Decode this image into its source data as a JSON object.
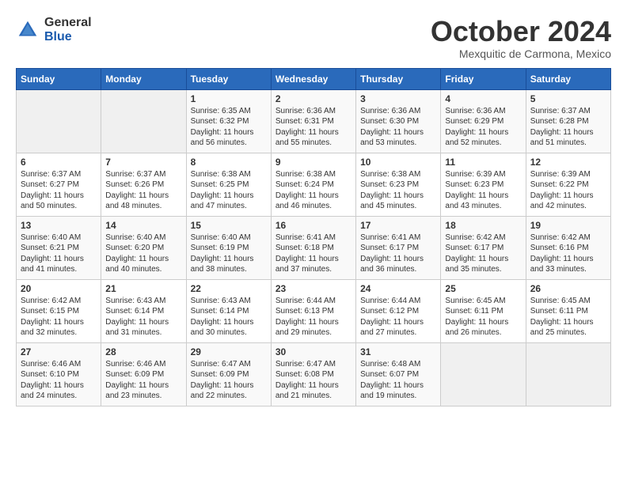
{
  "logo": {
    "general": "General",
    "blue": "Blue"
  },
  "title": "October 2024",
  "subtitle": "Mexquitic de Carmona, Mexico",
  "weekdays": [
    "Sunday",
    "Monday",
    "Tuesday",
    "Wednesday",
    "Thursday",
    "Friday",
    "Saturday"
  ],
  "weeks": [
    [
      {
        "day": "",
        "info": ""
      },
      {
        "day": "",
        "info": ""
      },
      {
        "day": "1",
        "info": "Sunrise: 6:35 AM\nSunset: 6:32 PM\nDaylight: 11 hours and 56 minutes."
      },
      {
        "day": "2",
        "info": "Sunrise: 6:36 AM\nSunset: 6:31 PM\nDaylight: 11 hours and 55 minutes."
      },
      {
        "day": "3",
        "info": "Sunrise: 6:36 AM\nSunset: 6:30 PM\nDaylight: 11 hours and 53 minutes."
      },
      {
        "day": "4",
        "info": "Sunrise: 6:36 AM\nSunset: 6:29 PM\nDaylight: 11 hours and 52 minutes."
      },
      {
        "day": "5",
        "info": "Sunrise: 6:37 AM\nSunset: 6:28 PM\nDaylight: 11 hours and 51 minutes."
      }
    ],
    [
      {
        "day": "6",
        "info": "Sunrise: 6:37 AM\nSunset: 6:27 PM\nDaylight: 11 hours and 50 minutes."
      },
      {
        "day": "7",
        "info": "Sunrise: 6:37 AM\nSunset: 6:26 PM\nDaylight: 11 hours and 48 minutes."
      },
      {
        "day": "8",
        "info": "Sunrise: 6:38 AM\nSunset: 6:25 PM\nDaylight: 11 hours and 47 minutes."
      },
      {
        "day": "9",
        "info": "Sunrise: 6:38 AM\nSunset: 6:24 PM\nDaylight: 11 hours and 46 minutes."
      },
      {
        "day": "10",
        "info": "Sunrise: 6:38 AM\nSunset: 6:23 PM\nDaylight: 11 hours and 45 minutes."
      },
      {
        "day": "11",
        "info": "Sunrise: 6:39 AM\nSunset: 6:23 PM\nDaylight: 11 hours and 43 minutes."
      },
      {
        "day": "12",
        "info": "Sunrise: 6:39 AM\nSunset: 6:22 PM\nDaylight: 11 hours and 42 minutes."
      }
    ],
    [
      {
        "day": "13",
        "info": "Sunrise: 6:40 AM\nSunset: 6:21 PM\nDaylight: 11 hours and 41 minutes."
      },
      {
        "day": "14",
        "info": "Sunrise: 6:40 AM\nSunset: 6:20 PM\nDaylight: 11 hours and 40 minutes."
      },
      {
        "day": "15",
        "info": "Sunrise: 6:40 AM\nSunset: 6:19 PM\nDaylight: 11 hours and 38 minutes."
      },
      {
        "day": "16",
        "info": "Sunrise: 6:41 AM\nSunset: 6:18 PM\nDaylight: 11 hours and 37 minutes."
      },
      {
        "day": "17",
        "info": "Sunrise: 6:41 AM\nSunset: 6:17 PM\nDaylight: 11 hours and 36 minutes."
      },
      {
        "day": "18",
        "info": "Sunrise: 6:42 AM\nSunset: 6:17 PM\nDaylight: 11 hours and 35 minutes."
      },
      {
        "day": "19",
        "info": "Sunrise: 6:42 AM\nSunset: 6:16 PM\nDaylight: 11 hours and 33 minutes."
      }
    ],
    [
      {
        "day": "20",
        "info": "Sunrise: 6:42 AM\nSunset: 6:15 PM\nDaylight: 11 hours and 32 minutes."
      },
      {
        "day": "21",
        "info": "Sunrise: 6:43 AM\nSunset: 6:14 PM\nDaylight: 11 hours and 31 minutes."
      },
      {
        "day": "22",
        "info": "Sunrise: 6:43 AM\nSunset: 6:14 PM\nDaylight: 11 hours and 30 minutes."
      },
      {
        "day": "23",
        "info": "Sunrise: 6:44 AM\nSunset: 6:13 PM\nDaylight: 11 hours and 29 minutes."
      },
      {
        "day": "24",
        "info": "Sunrise: 6:44 AM\nSunset: 6:12 PM\nDaylight: 11 hours and 27 minutes."
      },
      {
        "day": "25",
        "info": "Sunrise: 6:45 AM\nSunset: 6:11 PM\nDaylight: 11 hours and 26 minutes."
      },
      {
        "day": "26",
        "info": "Sunrise: 6:45 AM\nSunset: 6:11 PM\nDaylight: 11 hours and 25 minutes."
      }
    ],
    [
      {
        "day": "27",
        "info": "Sunrise: 6:46 AM\nSunset: 6:10 PM\nDaylight: 11 hours and 24 minutes."
      },
      {
        "day": "28",
        "info": "Sunrise: 6:46 AM\nSunset: 6:09 PM\nDaylight: 11 hours and 23 minutes."
      },
      {
        "day": "29",
        "info": "Sunrise: 6:47 AM\nSunset: 6:09 PM\nDaylight: 11 hours and 22 minutes."
      },
      {
        "day": "30",
        "info": "Sunrise: 6:47 AM\nSunset: 6:08 PM\nDaylight: 11 hours and 21 minutes."
      },
      {
        "day": "31",
        "info": "Sunrise: 6:48 AM\nSunset: 6:07 PM\nDaylight: 11 hours and 19 minutes."
      },
      {
        "day": "",
        "info": ""
      },
      {
        "day": "",
        "info": ""
      }
    ]
  ]
}
